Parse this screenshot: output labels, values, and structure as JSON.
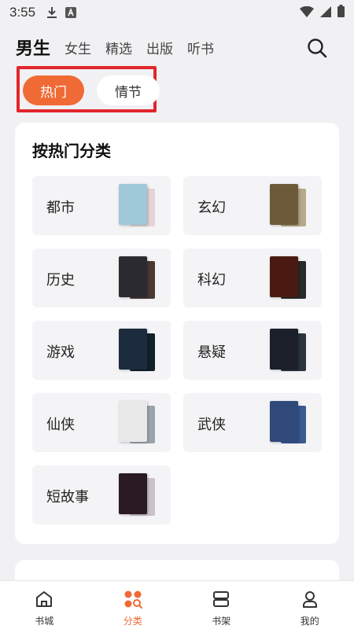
{
  "status_bar": {
    "time": "3:55"
  },
  "top_nav": {
    "tabs": [
      {
        "label": "男生",
        "active": true
      },
      {
        "label": "女生",
        "active": false
      },
      {
        "label": "精选",
        "active": false
      },
      {
        "label": "出版",
        "active": false
      },
      {
        "label": "听书",
        "active": false
      }
    ]
  },
  "sub_tabs": [
    {
      "label": "热门",
      "active": true
    },
    {
      "label": "情节",
      "active": false
    }
  ],
  "section": {
    "title": "按热门分类",
    "categories": [
      {
        "label": "都市",
        "cover": "#9fc8d8",
        "cover_back": "#e7d3d6"
      },
      {
        "label": "玄幻",
        "cover": "#6d5a3a",
        "cover_back": "#b7a88a"
      },
      {
        "label": "历史",
        "cover": "#2b2a30",
        "cover_back": "#4b3a34"
      },
      {
        "label": "科幻",
        "cover": "#4a1a12",
        "cover_back": "#2a2a2a"
      },
      {
        "label": "游戏",
        "cover": "#1c2b3d",
        "cover_back": "#12202c"
      },
      {
        "label": "悬疑",
        "cover": "#1a1f2a",
        "cover_back": "#2c3440"
      },
      {
        "label": "仙侠",
        "cover": "#e8e8e8",
        "cover_back": "#9aa4aa"
      },
      {
        "label": "武侠",
        "cover": "#2f4a7a",
        "cover_back": "#3a5a92"
      },
      {
        "label": "短故事",
        "cover": "#2a1a22",
        "cover_back": "#c9c2c6"
      }
    ]
  },
  "bottom_nav": [
    {
      "label": "书城",
      "icon": "home-icon",
      "active": false
    },
    {
      "label": "分类",
      "icon": "category-icon",
      "active": true
    },
    {
      "label": "书架",
      "icon": "bookshelf-icon",
      "active": false
    },
    {
      "label": "我的",
      "icon": "profile-icon",
      "active": false
    }
  ],
  "colors": {
    "accent": "#f06a35",
    "highlight_box": "#e2262b"
  }
}
